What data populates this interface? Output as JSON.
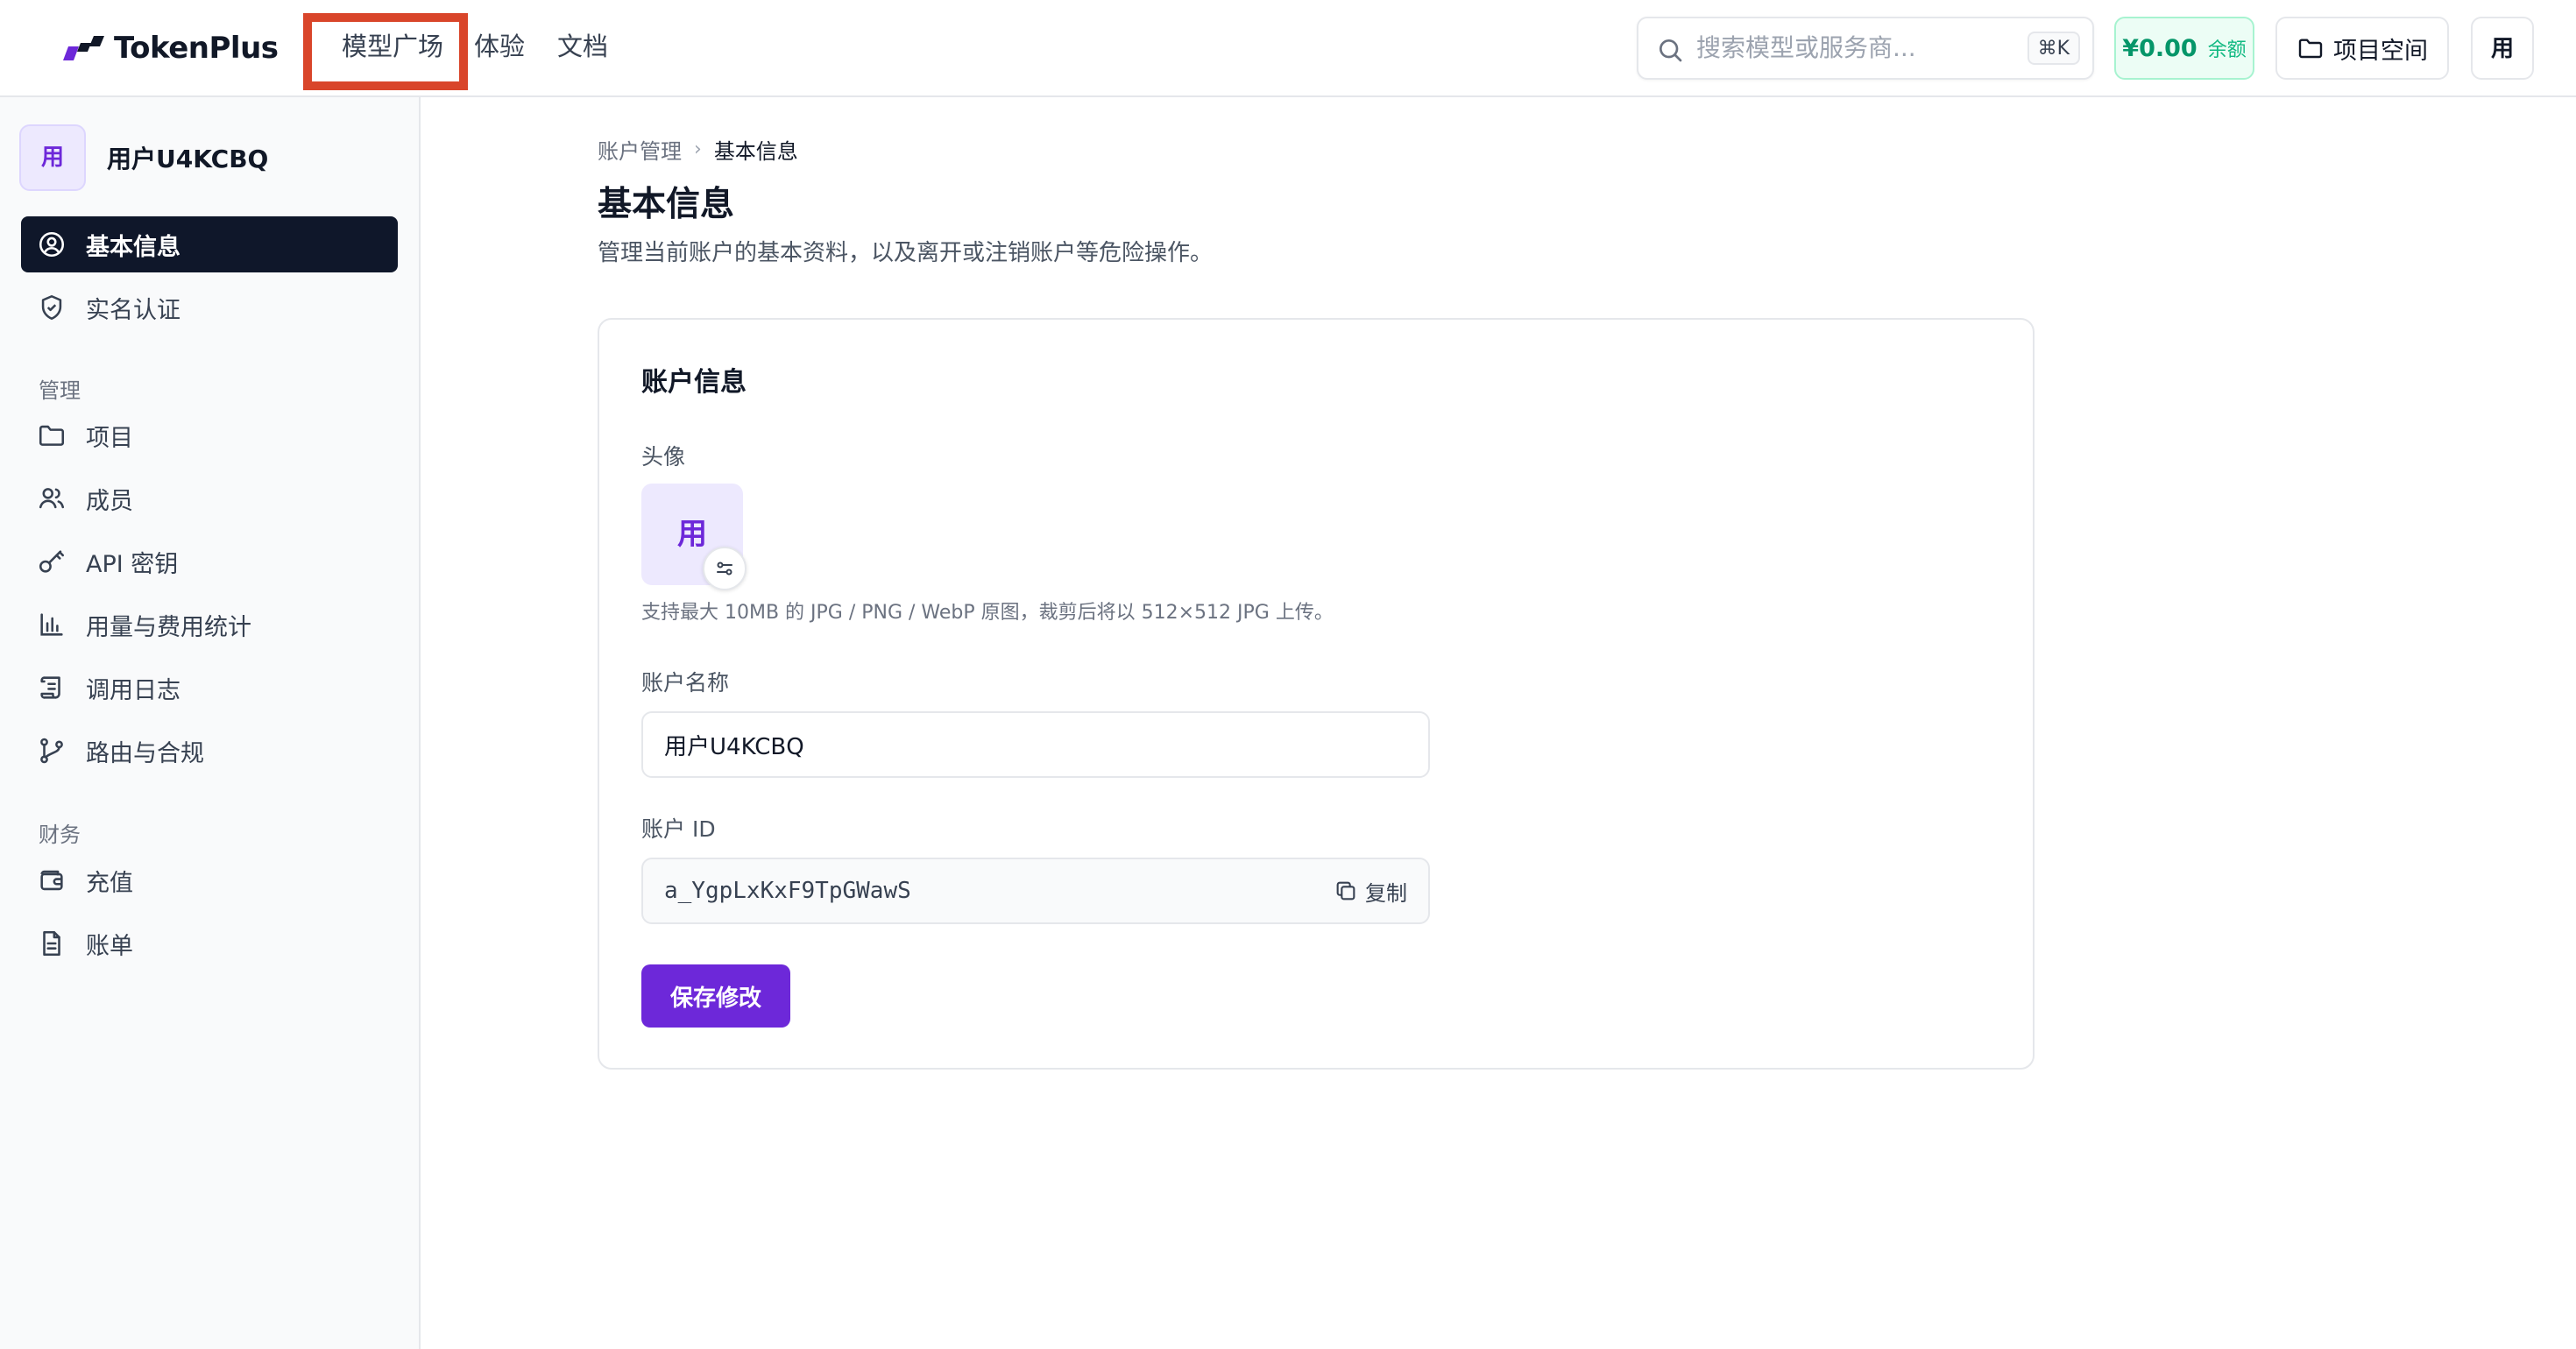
{
  "app": {
    "name": "TokenPlus"
  },
  "topnav": {
    "links": [
      "模型广场",
      "体验",
      "文档"
    ],
    "search_placeholder": "搜索模型或服务商...",
    "search_shortcut": "⌘K",
    "balance_amount": "¥0.00",
    "balance_label": "余额",
    "workspace_label": "项目空间",
    "user_initial": "用"
  },
  "sidebar": {
    "user_initial": "用",
    "user_name": "用户U4KCBQ",
    "account_items": [
      {
        "label": "基本信息",
        "icon": "user-circle-icon",
        "active": true
      },
      {
        "label": "实名认证",
        "icon": "shield-check-icon",
        "active": false
      }
    ],
    "manage_title": "管理",
    "manage_items": [
      {
        "label": "项目",
        "icon": "folder-icon"
      },
      {
        "label": "成员",
        "icon": "users-icon"
      },
      {
        "label": "API 密钥",
        "icon": "key-icon"
      },
      {
        "label": "用量与费用统计",
        "icon": "bar-chart-icon"
      },
      {
        "label": "调用日志",
        "icon": "scroll-icon"
      },
      {
        "label": "路由与合规",
        "icon": "git-branch-icon"
      }
    ],
    "finance_title": "财务",
    "finance_items": [
      {
        "label": "充值",
        "icon": "wallet-icon"
      },
      {
        "label": "账单",
        "icon": "document-icon"
      }
    ]
  },
  "main": {
    "breadcrumb": [
      "账户管理",
      "基本信息"
    ],
    "title": "基本信息",
    "subtitle": "管理当前账户的基本资料，以及离开或注销账户等危险操作。",
    "card": {
      "title": "账户信息",
      "avatar_label": "头像",
      "avatar_initial": "用",
      "avatar_hint": "支持最大 10MB 的 JPG / PNG / WebP 原图，裁剪后将以 512×512 JPG 上传。",
      "name_label": "账户名称",
      "name_value": "用户U4KCBQ",
      "id_label": "账户 ID",
      "id_value": "a_YgpLxKxF9TpGWawS",
      "copy_label": "复制",
      "save_label": "保存修改"
    }
  },
  "colors": {
    "accent": "#6d28d9",
    "active_nav": "#0f172a",
    "balance": "#059669",
    "highlight_box": "#d9452a"
  }
}
